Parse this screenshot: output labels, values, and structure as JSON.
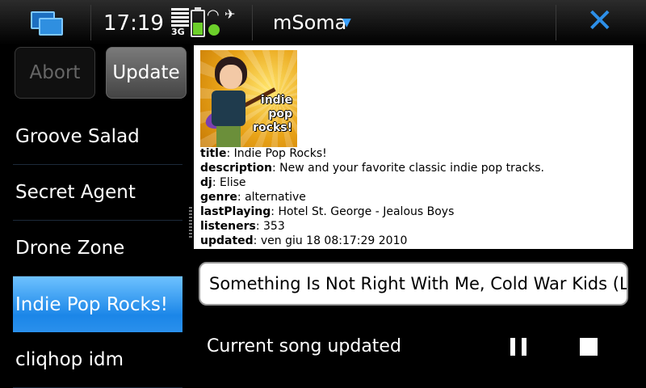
{
  "statusbar": {
    "time": "17:19",
    "network": "3G",
    "app_title": "mSoma",
    "icons": [
      "task-switcher-icon",
      "signal-icon",
      "battery-icon",
      "wifi-icon",
      "satellite-icon",
      "close-icon"
    ],
    "colors": {
      "accent": "#2d8fe8",
      "battery": "#6ccf2a"
    }
  },
  "buttons": {
    "abort": "Abort",
    "update": "Update"
  },
  "stations": [
    {
      "label": "Groove Salad",
      "selected": false
    },
    {
      "label": "Secret Agent",
      "selected": false
    },
    {
      "label": "Drone Zone",
      "selected": false
    },
    {
      "label": "Indie Pop Rocks!",
      "selected": true
    },
    {
      "label": "cliqhop idm",
      "selected": false
    }
  ],
  "channel_info": {
    "cover_text": [
      "indie",
      "pop",
      "rocks!"
    ],
    "fields": [
      {
        "key": "title",
        "value": "Indie Pop Rocks!"
      },
      {
        "key": "description",
        "value": "New and your favorite classic indie pop tracks."
      },
      {
        "key": "dj",
        "value": "Elise"
      },
      {
        "key": "genre",
        "value": "alternative"
      },
      {
        "key": "lastPlaying",
        "value": "Hotel St. George - Jealous Boys"
      },
      {
        "key": "listeners",
        "value": "353"
      },
      {
        "key": "updated",
        "value": "ven giu 18 08:17:29 2010"
      }
    ]
  },
  "now_playing": "Something Is Not Right With Me, Cold War Kids (L",
  "status_message": "Current song updated"
}
